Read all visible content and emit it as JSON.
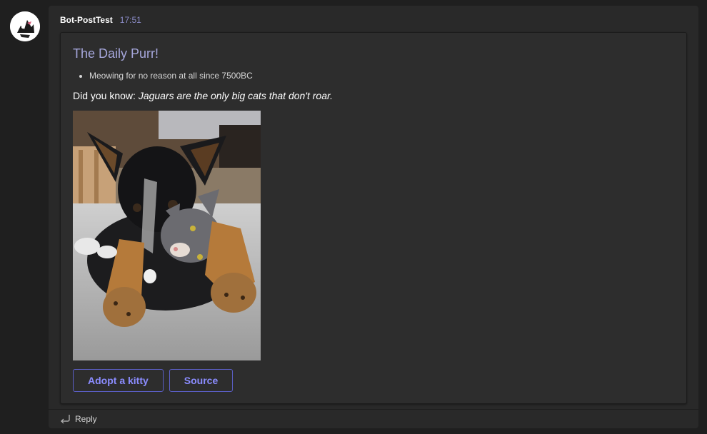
{
  "message": {
    "sender": "Bot-PostTest",
    "timestamp": "17:51",
    "avatar_icon": "bot-avatar-icon"
  },
  "card": {
    "title": "The Daily Purr!",
    "bullets": [
      "Meowing for no reason at all since 7500BC"
    ],
    "fact_prefix": "Did you know: ",
    "fact_text": "Jaguars are the only big cats that don't roar.",
    "image_icon": "dog-and-cat-photo",
    "actions": [
      "Adopt a kitty",
      "Source"
    ]
  },
  "reply": {
    "label": "Reply",
    "icon": "reply-arrow-icon"
  },
  "colors": {
    "background": "#1f1f1f",
    "message_bg": "#292929",
    "card_bg": "#2d2d2d",
    "title": "#a6a7dc",
    "timestamp": "#8b8cc7",
    "button_border": "#5b5fc7",
    "button_text": "#8b8cff"
  }
}
